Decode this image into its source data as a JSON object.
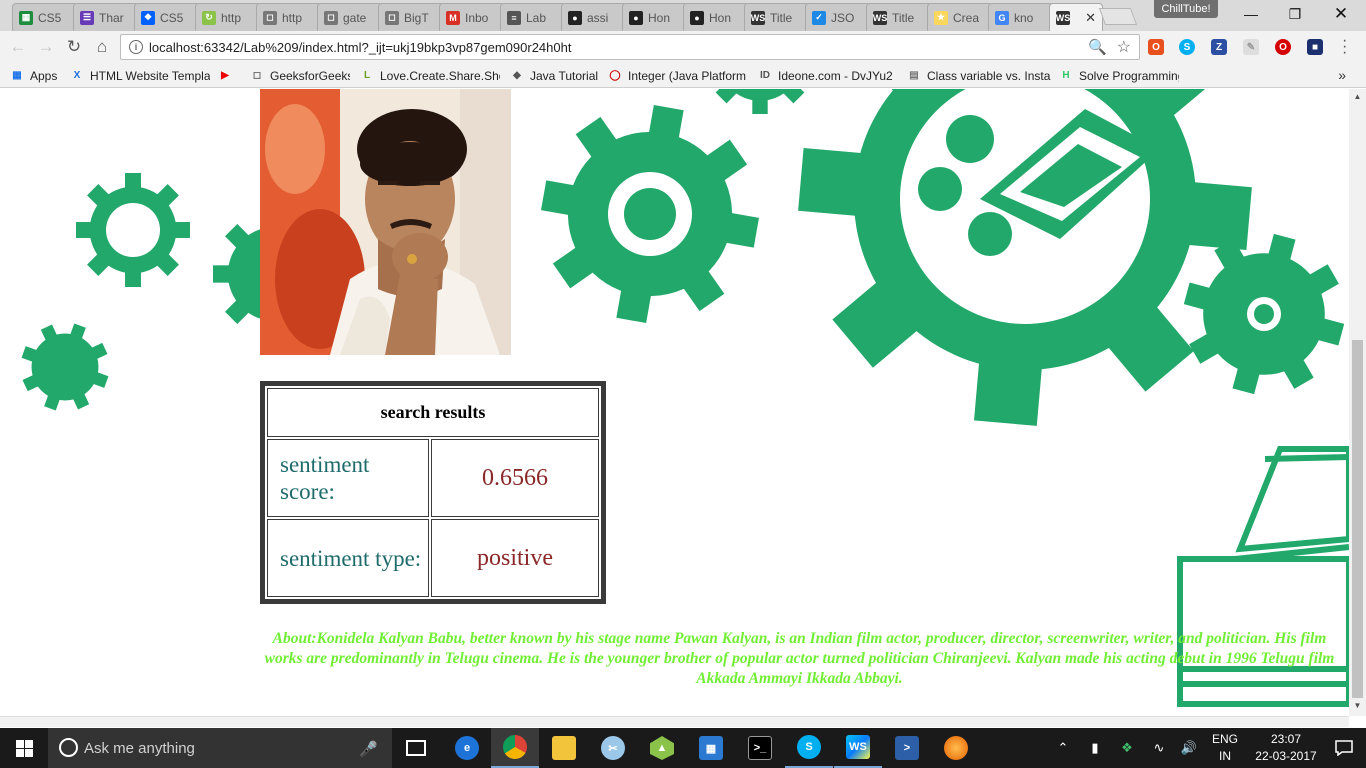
{
  "browser": {
    "tabs": [
      {
        "label": "CS5",
        "icon": "spreadsheet-icon",
        "color": "#1e8e3e"
      },
      {
        "label": "Thar",
        "icon": "forms-icon",
        "color": "#673ab7"
      },
      {
        "label": "CS5",
        "icon": "dropbox-icon",
        "color": "#0061fe"
      },
      {
        "label": "http",
        "icon": "loading-icon",
        "color": "#8bc34a"
      },
      {
        "label": "http",
        "icon": "page-icon",
        "color": "#777777"
      },
      {
        "label": "gate",
        "icon": "page-icon",
        "color": "#777777"
      },
      {
        "label": "BigT",
        "icon": "page-icon",
        "color": "#777777"
      },
      {
        "label": "Inbo",
        "icon": "gmail-icon",
        "color": "#d93025"
      },
      {
        "label": "Lab",
        "icon": "stack-icon",
        "color": "#555555"
      },
      {
        "label": "assi",
        "icon": "github-icon",
        "color": "#222222"
      },
      {
        "label": "Hon",
        "icon": "github-icon",
        "color": "#222222"
      },
      {
        "label": "Hon",
        "icon": "github-icon",
        "color": "#222222"
      },
      {
        "label": "Title",
        "icon": "webstorm-icon",
        "color": "#333333"
      },
      {
        "label": "JSO",
        "icon": "checkbox-icon",
        "color": "#1e88e5"
      },
      {
        "label": "Title",
        "icon": "webstorm-icon",
        "color": "#333333"
      },
      {
        "label": "Crea",
        "icon": "bulb-icon",
        "color": "#f9d65c"
      },
      {
        "label": "kno",
        "icon": "google-icon",
        "color": "#4285f4"
      },
      {
        "label": "",
        "icon": "webstorm-icon",
        "color": "#333333",
        "active": true
      }
    ],
    "profile_name": "ChillTube!",
    "url": "localhost:63342/Lab%209/index.html?_ijt=ukj19bkp3vp87gem090r24h0ht",
    "bookmarks": [
      {
        "label": "Apps",
        "icon": "apps-grid-icon"
      },
      {
        "label": "HTML Website Templa",
        "icon": "x-logo-icon"
      },
      {
        "label": "",
        "icon": "youtube-icon"
      },
      {
        "label": "GeeksforGeeks",
        "icon": "page-icon"
      },
      {
        "label": "Love.Create.Share.Sho",
        "icon": "l-logo-icon"
      },
      {
        "label": "Java Tutorial",
        "icon": "diamond-icon"
      },
      {
        "label": "Integer (Java Platform",
        "icon": "oracle-icon"
      },
      {
        "label": "Ideone.com - DvJYu2",
        "icon": "ideone-icon"
      },
      {
        "label": "Class variable vs. Insta",
        "icon": "monitor-icon"
      },
      {
        "label": "Solve Programming C",
        "icon": "hackerrank-icon"
      }
    ]
  },
  "page": {
    "results_table": {
      "heading": "search results",
      "rows": [
        {
          "key": "sentiment score:",
          "value": "0.6566"
        },
        {
          "key": "sentiment type:",
          "value": "positive"
        }
      ]
    },
    "about": "About:Konidela Kalyan Babu, better known by his stage name Pawan Kalyan, is an Indian film actor, producer, director, screenwriter, writer, and politician. His film works are predominantly in Telugu cinema. He is the younger brother of popular actor turned politician Chiranjeevi. Kalyan made his acting debut in 1996 Telugu film Akkada Ammayi Ikkada Abbayi.",
    "colors": {
      "gear_green": "#22a86a",
      "about_text": "#71ee34",
      "table_key": "#1f6b6b",
      "table_value": "#8b2828"
    }
  },
  "taskbar": {
    "search_placeholder": "Ask me anything",
    "language": "ENG",
    "region": "IN",
    "time": "23:07",
    "date": "22-03-2017"
  }
}
